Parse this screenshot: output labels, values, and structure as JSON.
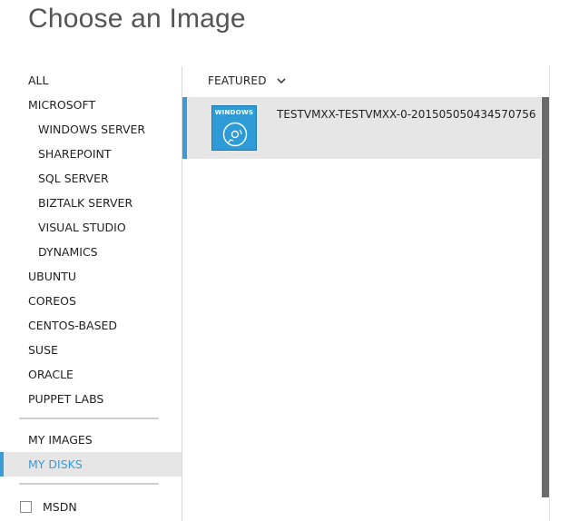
{
  "page": {
    "title": "Choose an Image"
  },
  "sidebar": {
    "items": [
      {
        "label": "ALL",
        "level": 0
      },
      {
        "label": "MICROSOFT",
        "level": 0
      },
      {
        "label": "WINDOWS SERVER",
        "level": 1
      },
      {
        "label": "SHAREPOINT",
        "level": 1
      },
      {
        "label": "SQL SERVER",
        "level": 1
      },
      {
        "label": "BIZTALK SERVER",
        "level": 1
      },
      {
        "label": "VISUAL STUDIO",
        "level": 1
      },
      {
        "label": "DYNAMICS",
        "level": 1
      },
      {
        "label": "UBUNTU",
        "level": 0
      },
      {
        "label": "COREOS",
        "level": 0
      },
      {
        "label": "CENTOS-BASED",
        "level": 0
      },
      {
        "label": "SUSE",
        "level": 0
      },
      {
        "label": "ORACLE",
        "level": 0
      },
      {
        "label": "PUPPET LABS",
        "level": 0
      }
    ],
    "my_images": "MY IMAGES",
    "my_disks": "MY DISKS",
    "active": "MY DISKS",
    "msdn": {
      "label": "MSDN",
      "checked": false
    }
  },
  "main": {
    "filter": {
      "label": "FEATURED",
      "icon": "chevron-down-icon"
    },
    "images": [
      {
        "name": "TESTVMXX-TESTVMXX-0-201505050434570756",
        "tile_text": "WINDOWS",
        "icon": "disc-icon",
        "selected": true
      }
    ]
  },
  "colors": {
    "accent": "#3a9bd5",
    "tile": "#2e9bd6",
    "selected_bg": "#e6e6e6",
    "scrollbar": "#6b6b6b"
  }
}
